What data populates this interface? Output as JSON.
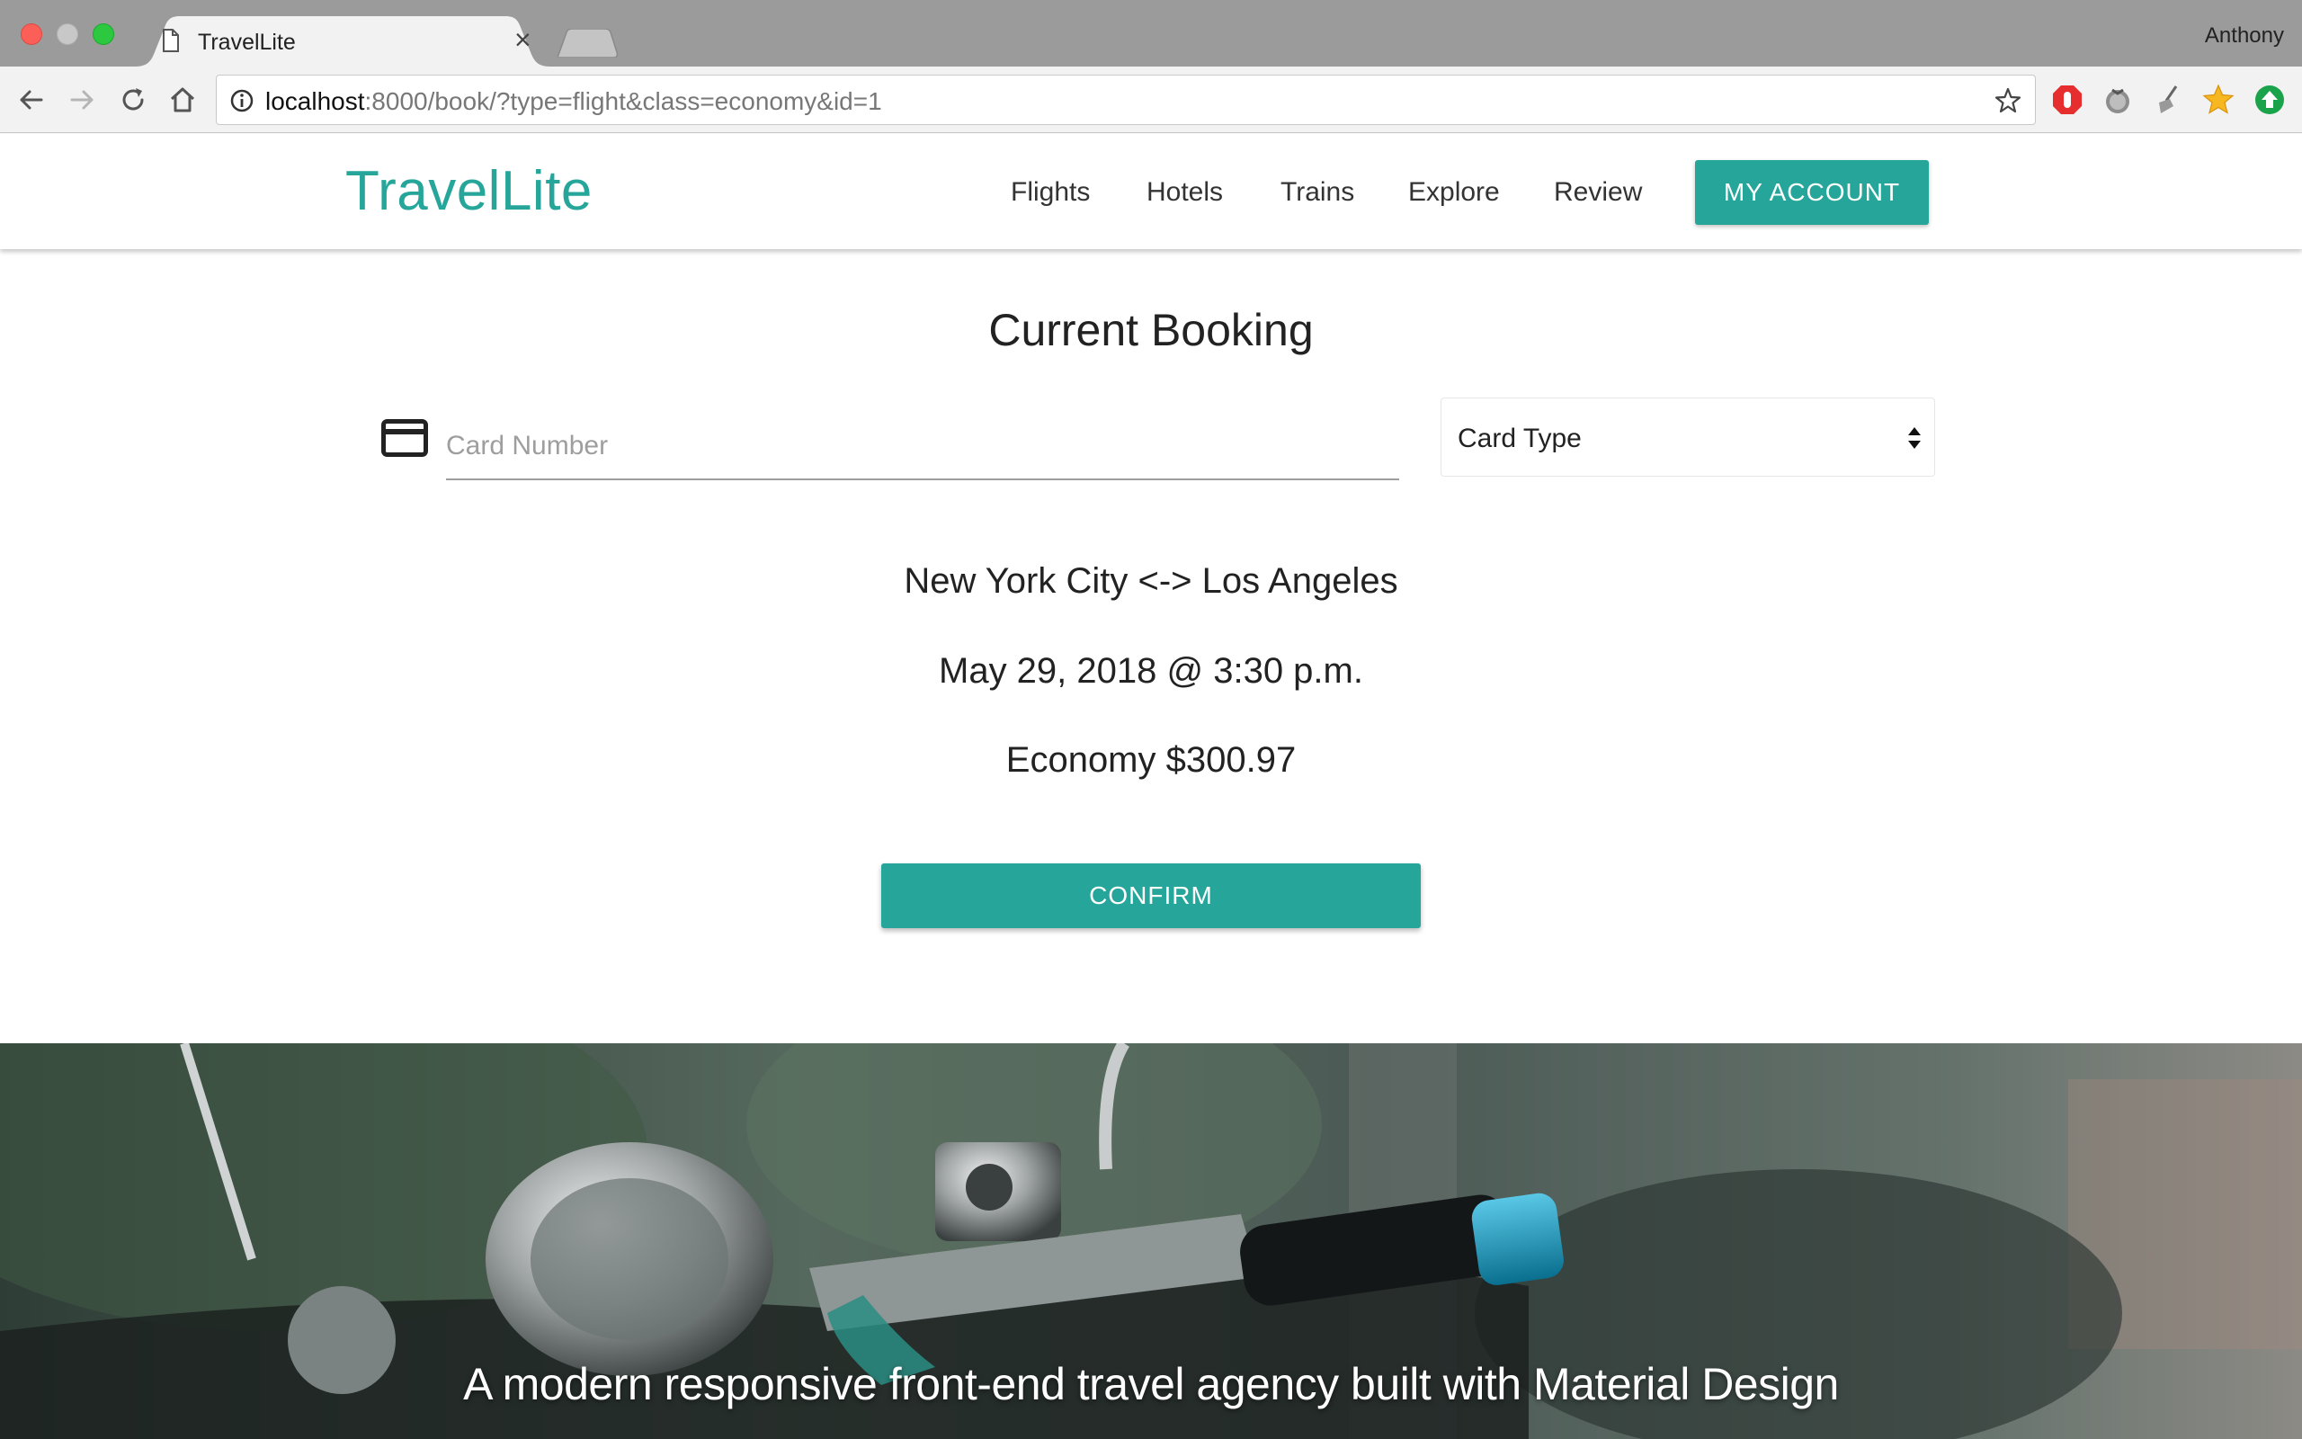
{
  "browser": {
    "tab_title": "TravelLite",
    "tab_close": "×",
    "profile_name": "Anthony",
    "url_host": "localhost",
    "url_rest": ":8000/book/?type=flight&class=economy&id=1"
  },
  "header": {
    "brand": "TravelLite",
    "nav": [
      "Flights",
      "Hotels",
      "Trains",
      "Explore",
      "Review"
    ],
    "account_button": "MY ACCOUNT"
  },
  "main": {
    "heading": "Current Booking",
    "card_number_placeholder": "Card Number",
    "card_type_label": "Card Type",
    "route": "New York City <-> Los Angeles",
    "datetime": "May 29, 2018 @ 3:30 p.m.",
    "fare": "Economy $300.97",
    "confirm_button": "CONFIRM"
  },
  "hero": {
    "tagline": "A modern responsive front-end travel agency built with Material Design"
  },
  "colors": {
    "accent": "#26a69a"
  },
  "icons": {
    "card": "credit-card-icon",
    "select": "select-arrows-icon",
    "back": "back-arrow-icon",
    "forward": "forward-arrow-icon",
    "reload": "reload-icon",
    "home": "home-icon",
    "info": "info-icon",
    "bookmark": "star-icon"
  }
}
